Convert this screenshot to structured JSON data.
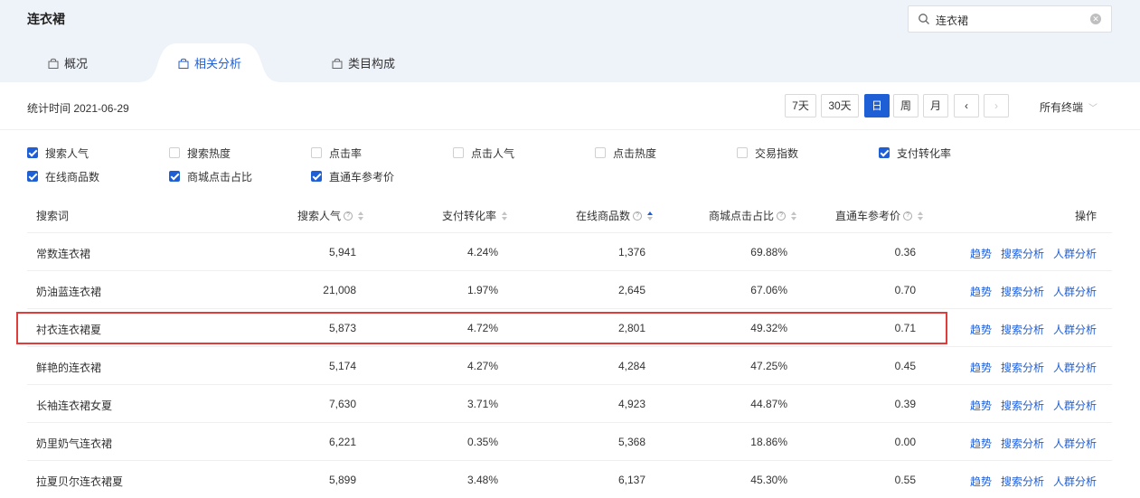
{
  "header": {
    "title": "连衣裙",
    "search": {
      "value": "连衣裙"
    },
    "tabs": [
      {
        "label": "概况",
        "active": false,
        "icon": "bag-icon"
      },
      {
        "label": "相关分析",
        "active": true,
        "icon": "bag-icon"
      },
      {
        "label": "类目构成",
        "active": false,
        "icon": "bag-icon"
      }
    ]
  },
  "toolbar": {
    "stat_time": "统计时间 2021-06-29",
    "ranges": [
      "7天",
      "30天",
      "日",
      "周",
      "月"
    ],
    "active_range": "日",
    "terminal": "所有终端"
  },
  "filters": [
    {
      "label": "搜索人气",
      "checked": true
    },
    {
      "label": "搜索热度",
      "checked": false
    },
    {
      "label": "点击率",
      "checked": false
    },
    {
      "label": "点击人气",
      "checked": false
    },
    {
      "label": "点击热度",
      "checked": false
    },
    {
      "label": "交易指数",
      "checked": false
    },
    {
      "label": "支付转化率",
      "checked": true
    },
    {
      "label": "在线商品数",
      "checked": true
    },
    {
      "label": "商城点击占比",
      "checked": true
    },
    {
      "label": "直通车参考价",
      "checked": true
    }
  ],
  "table": {
    "columns": [
      "搜索词",
      "搜索人气",
      "支付转化率",
      "在线商品数",
      "商城点击占比",
      "直通车参考价",
      "操作"
    ],
    "sorted_column": "在线商品数",
    "sort_direction": "ascending",
    "rows": [
      [
        "常数连衣裙",
        "5,941",
        "4.24%",
        "1,376",
        "69.88%",
        "0.36"
      ],
      [
        "奶油蓝连衣裙",
        "21,008",
        "1.97%",
        "2,645",
        "67.06%",
        "0.70"
      ],
      [
        "衬衣连衣裙夏",
        "5,873",
        "4.72%",
        "2,801",
        "49.32%",
        "0.71"
      ],
      [
        "鲜艳的连衣裙",
        "5,174",
        "4.27%",
        "4,284",
        "47.25%",
        "0.45"
      ],
      [
        "长袖连衣裙女夏",
        "7,630",
        "3.71%",
        "4,923",
        "44.87%",
        "0.39"
      ],
      [
        "奶里奶气连衣裙",
        "6,221",
        "0.35%",
        "5,368",
        "18.86%",
        "0.00"
      ],
      [
        "拉夏贝尔连衣裙夏",
        "5,899",
        "3.48%",
        "6,137",
        "45.30%",
        "0.55"
      ]
    ],
    "actions": [
      "趋势",
      "搜索分析",
      "人群分析"
    ],
    "highlighted_row": 2
  },
  "colors": {
    "accent": "#1e5fd6",
    "highlight": "#e03c3c",
    "header_bg": "#eef2f9"
  }
}
